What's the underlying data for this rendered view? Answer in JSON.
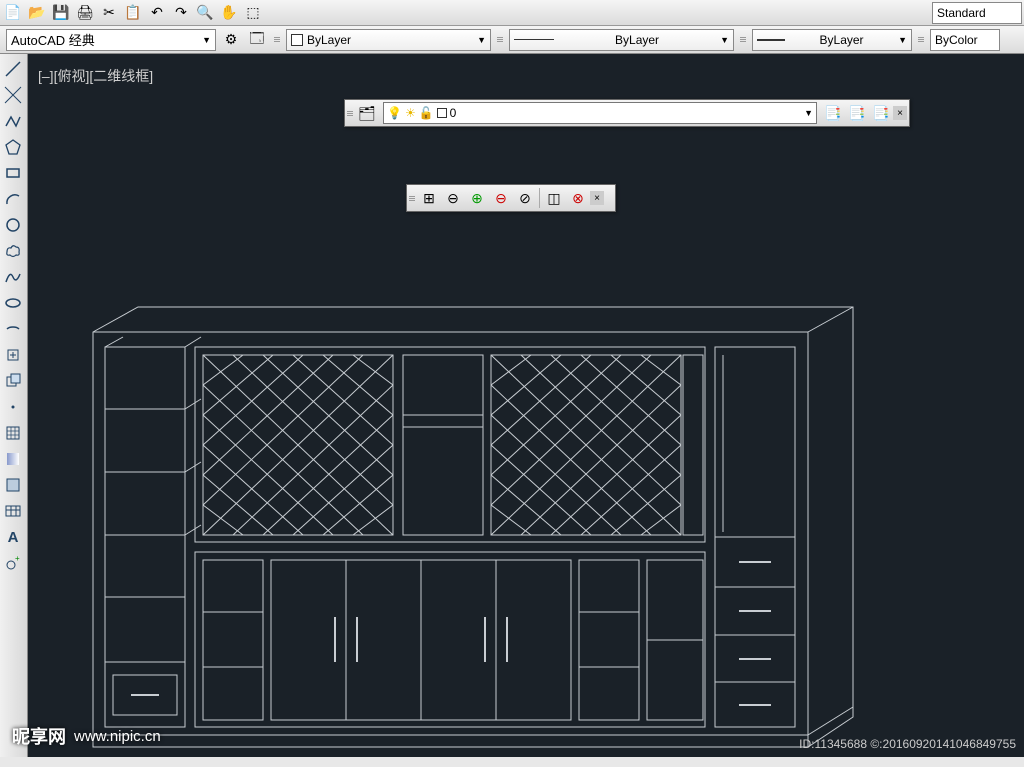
{
  "topbar": {
    "standard_label": "Standard"
  },
  "workspace": {
    "current": "AutoCAD 经典"
  },
  "props": {
    "layer_label": "ByLayer",
    "linetype_label": "ByLayer",
    "lineweight_label": "ByLayer",
    "color_label": "ByColor"
  },
  "viewport": {
    "label": "[–][俯视][二维线框]"
  },
  "layer_toolbar": {
    "current_layer": "0"
  },
  "watermark": {
    "site_name": "昵享网",
    "site_url": "www.nipic.cn",
    "id_label": "ID:11345688 ©:20160920141046849755"
  }
}
